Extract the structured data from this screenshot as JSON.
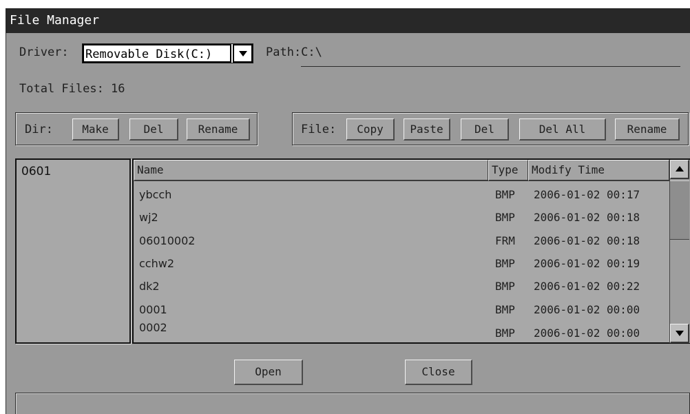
{
  "window": {
    "title": "File Manager"
  },
  "driver": {
    "label": "Driver:",
    "value": "Removable Disk(C:)"
  },
  "path": {
    "label": "Path:C:\\"
  },
  "total_files": {
    "label": "Total Files: 16"
  },
  "dir_group": {
    "label": "Dir:",
    "make": "Make",
    "del": "Del",
    "rename": "Rename"
  },
  "file_group": {
    "label": "File:",
    "copy": "Copy",
    "paste": "Paste",
    "del": "Del",
    "del_all": "Del All",
    "rename": "Rename"
  },
  "dir_list": {
    "items": [
      "0601"
    ]
  },
  "table": {
    "columns": [
      "Name",
      "Type",
      "Modify Time"
    ],
    "rows": [
      {
        "name": "ybcch",
        "type": "BMP",
        "time": "2006-01-02 00:17"
      },
      {
        "name": "wj2",
        "type": "BMP",
        "time": "2006-01-02 00:18"
      },
      {
        "name": "06010002",
        "type": "FRM",
        "time": "2006-01-02 00:18"
      },
      {
        "name": "cchw2",
        "type": "BMP",
        "time": "2006-01-02 00:19"
      },
      {
        "name": "dk2",
        "type": "BMP",
        "time": "2006-01-02 00:22"
      },
      {
        "name": "0001",
        "type": "BMP",
        "time": "2006-01-02 00:00"
      },
      {
        "name": "0002",
        "type": "BMP",
        "time": "2006-01-02 00:00"
      }
    ]
  },
  "actions": {
    "open": "Open",
    "close": "Close"
  },
  "icons": {
    "dropdown": "chevron-down-icon",
    "scroll_up": "arrow-up-icon",
    "scroll_down": "arrow-down-icon"
  }
}
